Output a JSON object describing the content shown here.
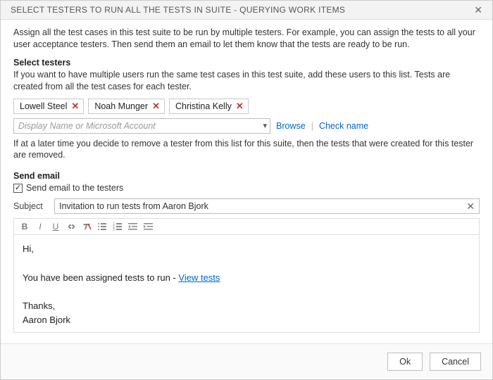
{
  "title": "SELECT TESTERS TO RUN ALL THE TESTS IN SUITE - QUERYING WORK ITEMS",
  "intro": "Assign all the test cases in this test suite to be run by multiple testers. For example, you can assign the tests to all your user acceptance testers. Then send them an email to let them know that the tests are ready to be run.",
  "select_testers": {
    "heading": "Select testers",
    "desc": "If you want to have multiple users run the same test cases in this test suite, add these users to this list. Tests are created from all the test cases for each tester.",
    "chips": [
      {
        "name": "Lowell Steel"
      },
      {
        "name": "Noah Munger"
      },
      {
        "name": "Christina Kelly"
      }
    ],
    "placeholder": "Display Name or Microsoft Account",
    "browse": "Browse",
    "check_name": "Check name",
    "note": "If at a later time you decide to remove a tester from this list for this suite, then the tests that were created for this tester are removed."
  },
  "send_email": {
    "heading": "Send email",
    "checkbox_label": "Send email to the testers",
    "checked": true,
    "subject_label": "Subject",
    "subject_value": "Invitation to run tests from Aaron Bjork",
    "body": {
      "greeting": "Hi,",
      "line_prefix": "You have been assigned tests to run - ",
      "link_text": "View tests",
      "signoff": "Thanks,",
      "name": "Aaron Bjork"
    }
  },
  "buttons": {
    "ok": "Ok",
    "cancel": "Cancel"
  }
}
